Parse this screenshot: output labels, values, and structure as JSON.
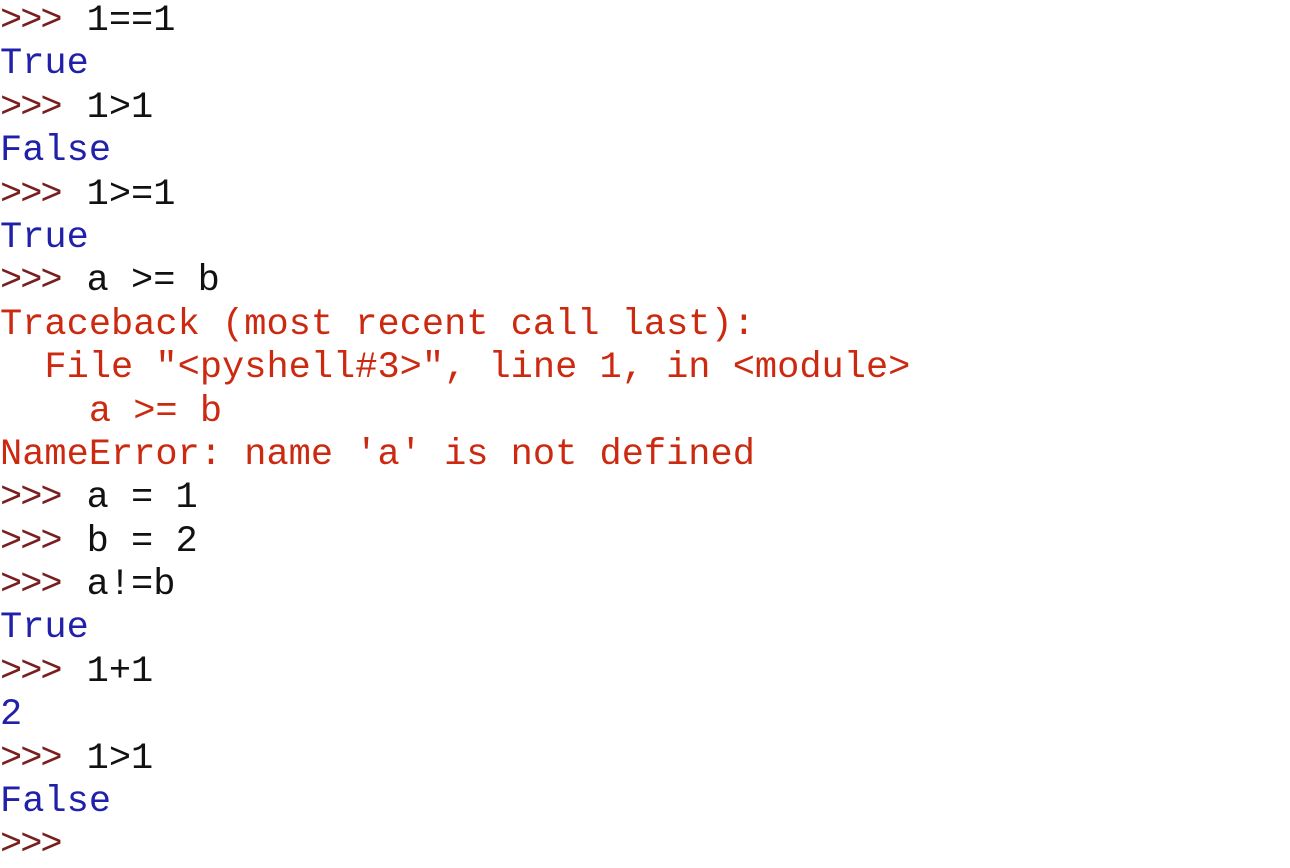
{
  "shell": {
    "prompt": ">>>",
    "lines": [
      {
        "kind": "input",
        "text": "1==1"
      },
      {
        "kind": "output",
        "text": "True"
      },
      {
        "kind": "input",
        "text": "1>1"
      },
      {
        "kind": "output",
        "text": "False"
      },
      {
        "kind": "input",
        "text": "1>=1"
      },
      {
        "kind": "output",
        "text": "True"
      },
      {
        "kind": "input",
        "text": "a >= b"
      },
      {
        "kind": "error",
        "text": "Traceback (most recent call last):"
      },
      {
        "kind": "error",
        "text": "  File \"<pyshell#3>\", line 1, in <module>"
      },
      {
        "kind": "error",
        "text": "    a >= b"
      },
      {
        "kind": "error",
        "text": "NameError: name 'a' is not defined"
      },
      {
        "kind": "input",
        "text": "a = 1"
      },
      {
        "kind": "input",
        "text": "b = 2"
      },
      {
        "kind": "input",
        "text": "a!=b"
      },
      {
        "kind": "output",
        "text": "True"
      },
      {
        "kind": "input",
        "text": "1+1"
      },
      {
        "kind": "output",
        "text": "2"
      },
      {
        "kind": "input",
        "text": "1>1"
      },
      {
        "kind": "output",
        "text": "False"
      },
      {
        "kind": "prompt-only",
        "text": ""
      }
    ]
  },
  "colors": {
    "prompt": "#7a1f1f",
    "input": "#111111",
    "output": "#2020a8",
    "error": "#cc2a10",
    "background": "#ffffff"
  }
}
